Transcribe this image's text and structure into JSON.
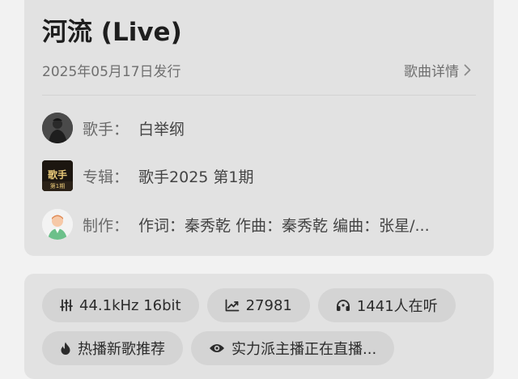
{
  "song": {
    "title": "河流 (Live)",
    "release_date": "2025年05月17日发行",
    "detail_link": "歌曲详情"
  },
  "singer": {
    "label": "歌手：",
    "name": "白举纲"
  },
  "album": {
    "label": "专辑：",
    "name": "歌手2025 第1期",
    "cover_text": "歌手",
    "cover_sub": "第1期"
  },
  "credits": {
    "label": "制作：",
    "text": "作词：秦秀乾  作曲：秦秀乾  编曲：张星/..."
  },
  "tags": {
    "quality": "44.1kHz  16bit",
    "plays": "27981",
    "listeners": "1441人在听",
    "hot": "热播新歌推荐",
    "live": "实力派主播正在直播..."
  }
}
